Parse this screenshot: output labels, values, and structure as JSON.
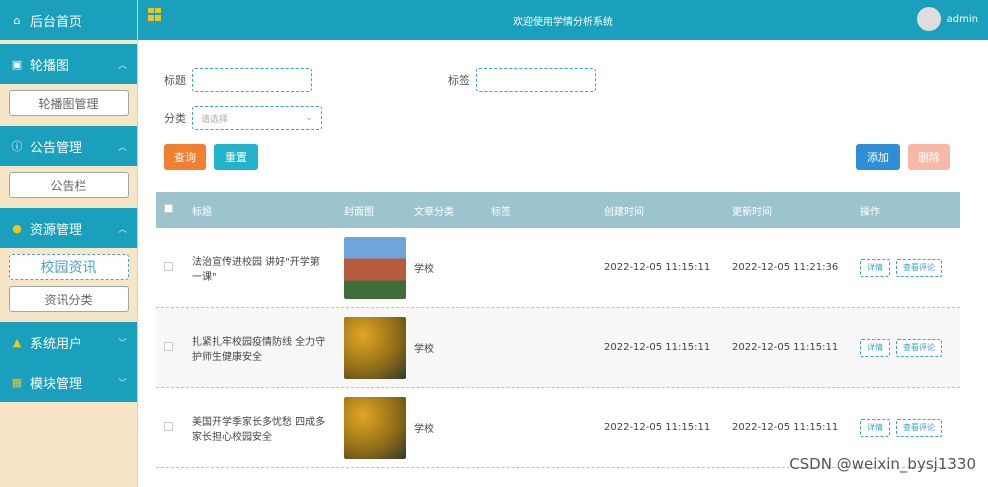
{
  "sidebar": {
    "home": "后台首页",
    "sections": [
      {
        "label": "轮播图",
        "items": [
          "轮播图管理"
        ]
      },
      {
        "label": "公告管理",
        "items": [
          "公告栏"
        ]
      },
      {
        "label": "资源管理",
        "items": [
          "校园资讯",
          "资讯分类"
        ]
      },
      {
        "label": "系统用户",
        "items": []
      },
      {
        "label": "模块管理",
        "items": []
      }
    ]
  },
  "topbar": {
    "title": "欢迎使用学情分析系统",
    "user": "admin"
  },
  "search": {
    "title_label": "标题",
    "tag_label": "标签",
    "category_label": "分类",
    "category_placeholder": "请选择",
    "query_button": "查询",
    "reset_button": "重置"
  },
  "actions": {
    "add": "添加",
    "delete": "删除"
  },
  "table": {
    "headers": [
      "标题",
      "封面图",
      "文章分类",
      "标签",
      "创建时间",
      "更新时间",
      "操作"
    ],
    "rows": [
      {
        "title": "法治宣传进校园 讲好\"开学第一课\"",
        "category": "学校",
        "tag": "",
        "created": "2022-12-05 11:15:11",
        "updated": "2022-12-05 11:21:36"
      },
      {
        "title": "扎紧扎牢校园疫情防线 全力守护师生健康安全",
        "category": "学校",
        "tag": "",
        "created": "2022-12-05 11:15:11",
        "updated": "2022-12-05 11:15:11"
      },
      {
        "title": "美国开学季家长多忧愁 四成多家长担心校园安全",
        "category": "学校",
        "tag": "",
        "created": "2022-12-05 11:15:11",
        "updated": "2022-12-05 11:15:11"
      }
    ],
    "detail_label": "详情",
    "comments_label": "查看评论"
  },
  "watermark": "CSDN @weixin_bysj1330",
  "colors": {
    "primary": "#1aa0bd",
    "sidebar_bg": "#F7E6C6",
    "query": "#f07f32",
    "reset": "#22b3cc",
    "add": "#2e8fd6",
    "delete": "#f7b8a8"
  }
}
